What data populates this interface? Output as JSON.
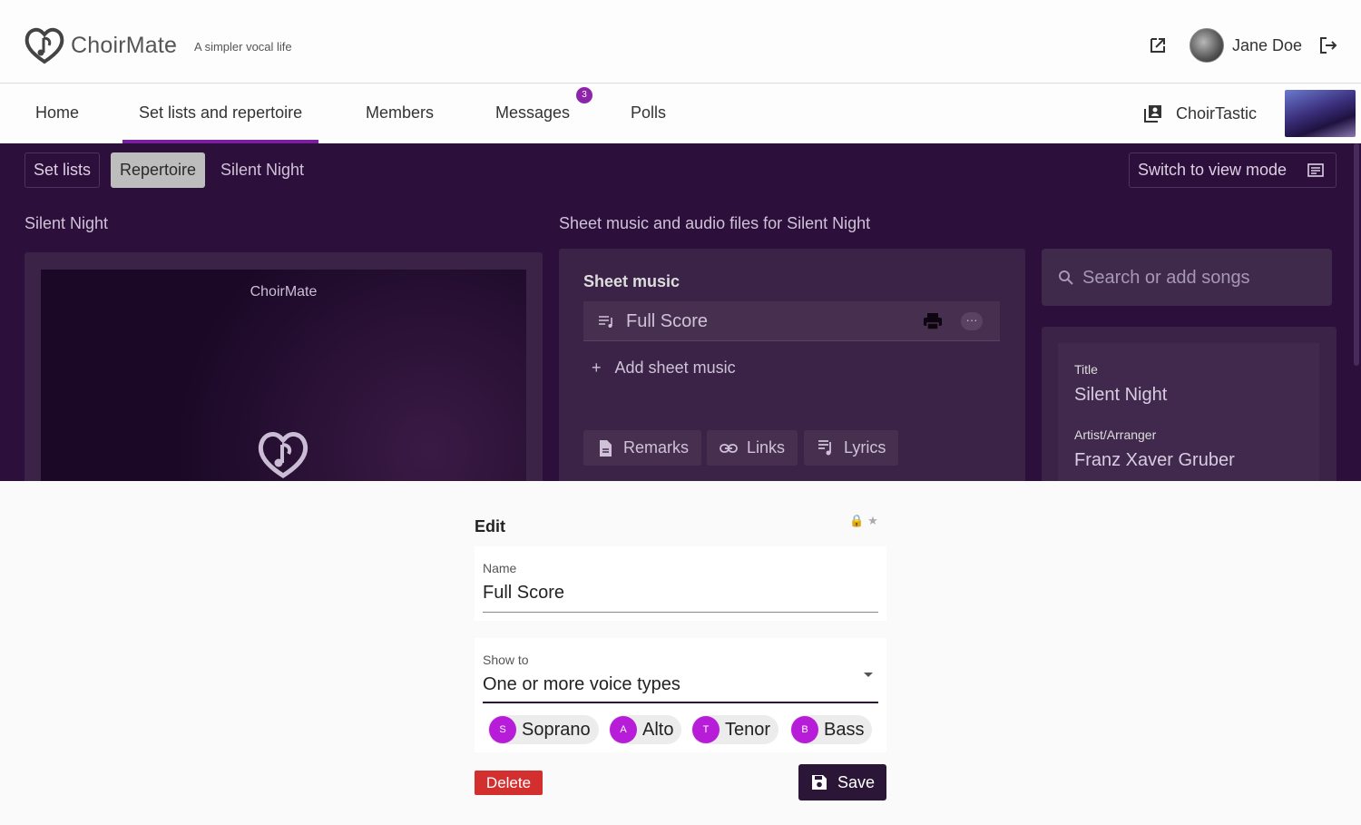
{
  "header": {
    "app_name": "ChoirMate",
    "tagline": "A simpler vocal life",
    "user_name": "Jane Doe"
  },
  "nav": {
    "tabs": [
      {
        "label": "Home"
      },
      {
        "label": "Set lists and repertoire",
        "active": true
      },
      {
        "label": "Members"
      },
      {
        "label": "Messages",
        "badge": "3"
      },
      {
        "label": "Polls"
      }
    ],
    "choir_name": "ChoirTastic"
  },
  "toolbar": {
    "set_lists": "Set lists",
    "repertoire": "Repertoire",
    "current_song": "Silent Night",
    "view_mode": "Switch to view mode"
  },
  "song": {
    "heading": "Silent Night",
    "cover_title": "ChoirMate",
    "files_heading": "Sheet music and audio files for Silent Night",
    "sheet_music_title": "Sheet music",
    "sheet_item": "Full Score",
    "more_dots": "···",
    "add_sheet": "Add sheet music",
    "tabs": [
      "Remarks",
      "Links",
      "Lyrics"
    ]
  },
  "search": {
    "placeholder": "Search or add songs"
  },
  "details": {
    "title_label": "Title",
    "title_value": "Silent Night",
    "artist_label": "Artist/Arranger",
    "artist_value": "Franz Xaver Gruber"
  },
  "edit_dialog": {
    "title": "Edit",
    "icons": "🔒★",
    "name_label": "Name",
    "name_value": "Full Score",
    "show_to_label": "Show to",
    "show_to_value": "One or more voice types",
    "voices": [
      {
        "initial": "S",
        "label": "Soprano"
      },
      {
        "initial": "A",
        "label": "Alto"
      },
      {
        "initial": "T",
        "label": "Tenor"
      },
      {
        "initial": "B",
        "label": "Bass"
      }
    ],
    "delete_label": "Delete",
    "save_label": "Save"
  },
  "colors": {
    "accent": "#7b1fa2",
    "content_bg": "#2c0f3a",
    "chip_dot": "#b71cd9",
    "delete": "#d32f2f",
    "save": "#2c1638"
  }
}
